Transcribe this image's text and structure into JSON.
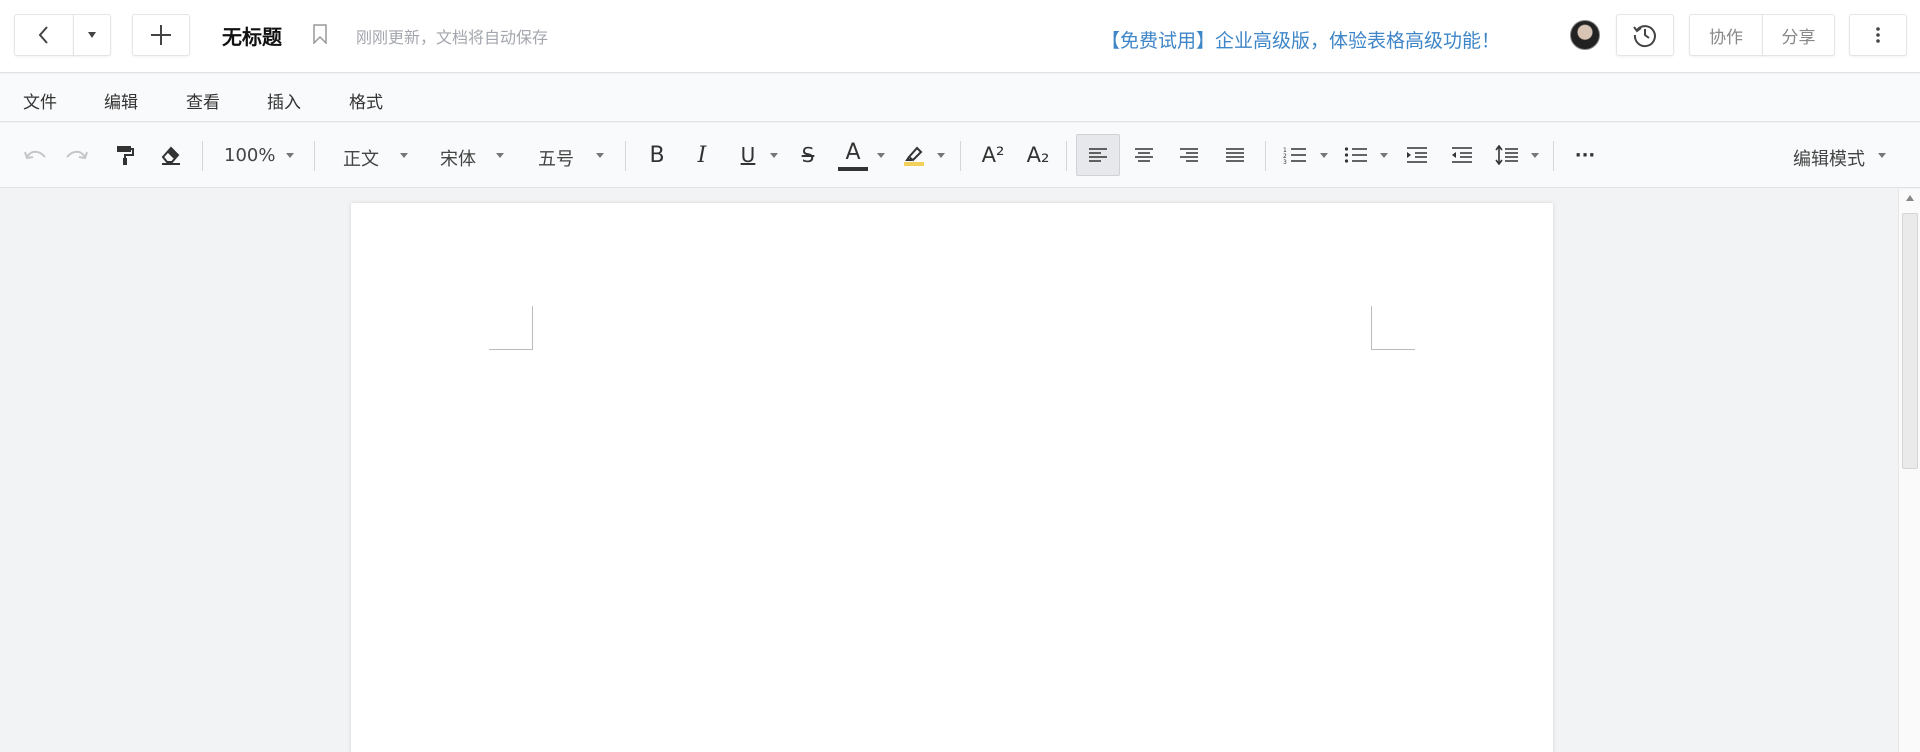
{
  "header": {
    "title": "无标题",
    "save_status": "刚刚更新，文档将自动保存",
    "promo": "【免费试用】企业高级版，体验表格高级功能！",
    "collab_label": "协作",
    "share_label": "分享"
  },
  "menu": {
    "items": [
      "文件",
      "编辑",
      "查看",
      "插入",
      "格式"
    ]
  },
  "toolbar": {
    "zoom": "100%",
    "paragraph_style": "正文",
    "font_family": "宋体",
    "font_size": "五号",
    "mode": "编辑模式",
    "bold_glyph": "B",
    "italic_glyph": "I",
    "underline_glyph": "U",
    "strike_glyph": "S",
    "font_color_glyph": "A",
    "superscript_glyph": "A²",
    "subscript_glyph": "A₂",
    "more_glyph": "···"
  },
  "colors": {
    "promo": "#3f86c8",
    "font_color_bar": "#333333",
    "highlight_bar": "#f2d15a"
  },
  "icons": [
    "back-icon",
    "dropdown-icon",
    "plus-icon",
    "bookmark-icon",
    "history-icon",
    "more-vertical-icon",
    "undo-icon",
    "redo-icon",
    "format-painter-icon",
    "eraser-icon",
    "highlight-icon",
    "align-left-icon",
    "align-center-icon",
    "align-right-icon",
    "justify-icon",
    "ordered-list-icon",
    "bullet-list-icon",
    "indent-increase-icon",
    "indent-decrease-icon",
    "line-spacing-icon"
  ]
}
